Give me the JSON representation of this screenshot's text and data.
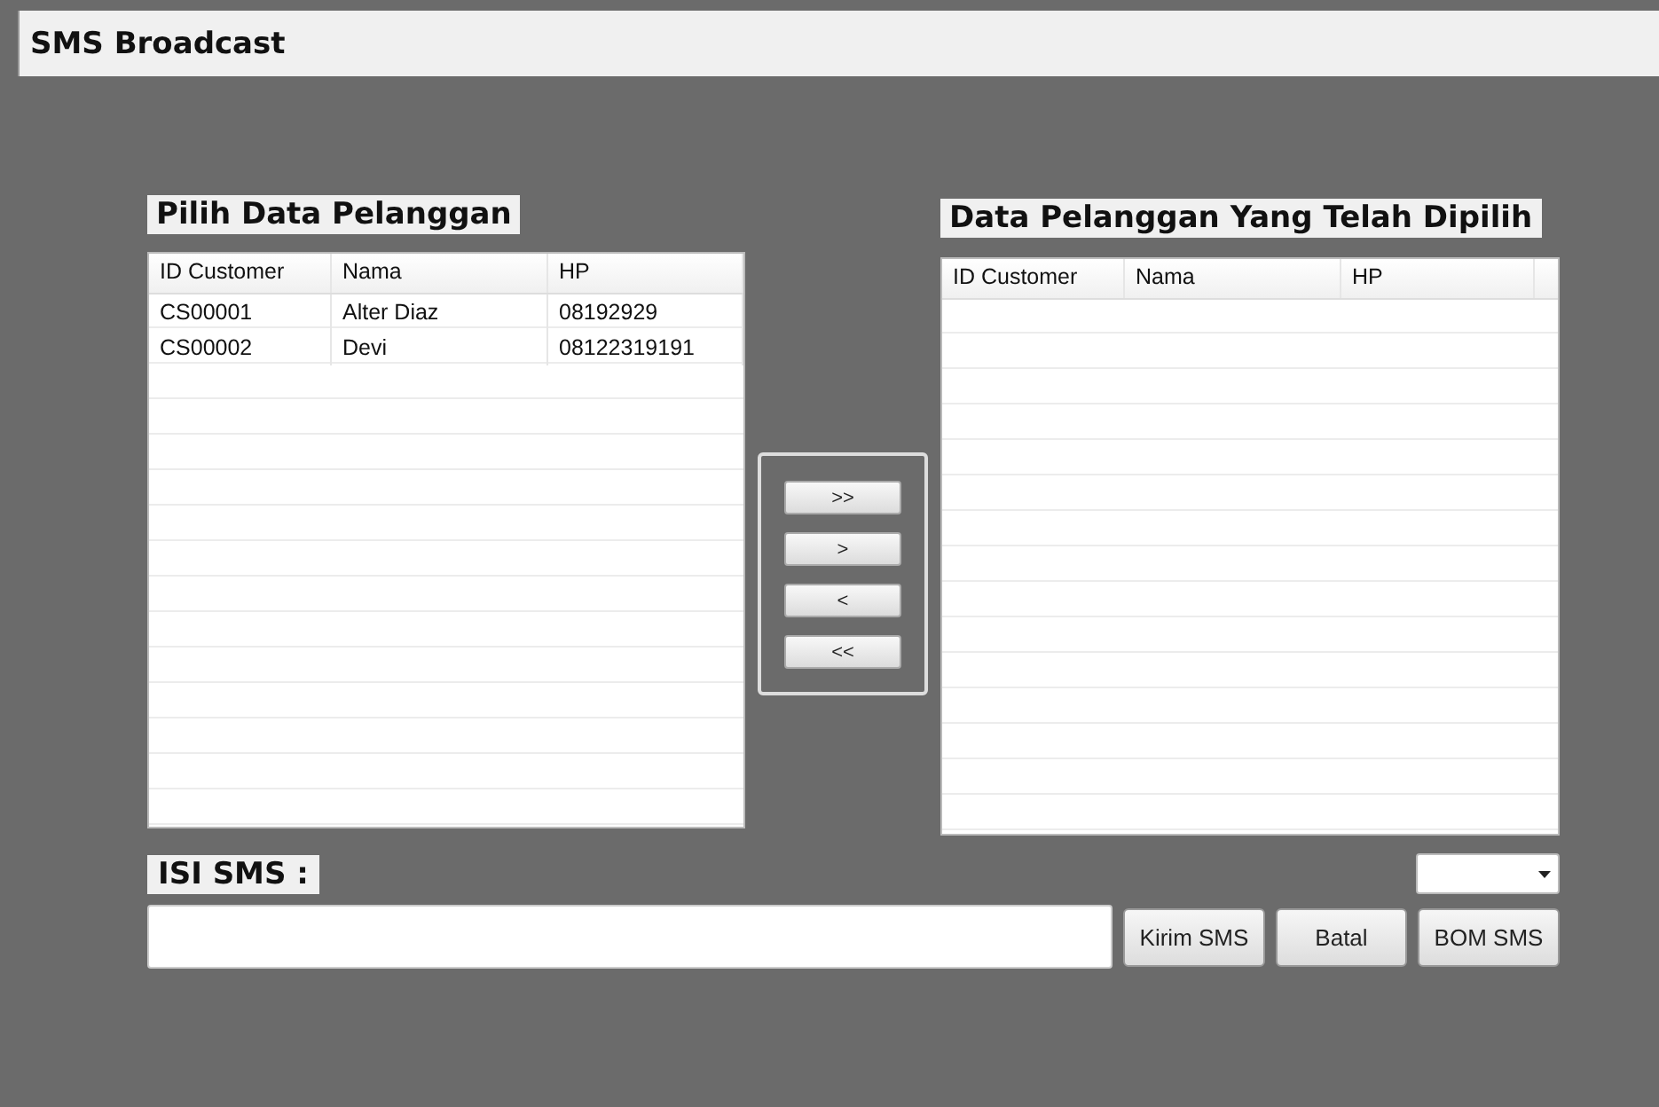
{
  "window": {
    "title": "SMS Broadcast"
  },
  "source_panel": {
    "heading": "Pilih Data Pelanggan",
    "columns": [
      "ID Customer",
      "Nama",
      "HP"
    ],
    "rows": [
      [
        "CS00001",
        "Alter Diaz",
        "08192929"
      ],
      [
        "CS00002",
        "Devi",
        "08122319191"
      ]
    ]
  },
  "transfer_buttons": [
    ">>",
    ">",
    "<",
    "<<"
  ],
  "selected_panel": {
    "heading": "Data Pelanggan Yang Telah Dipilih",
    "columns": [
      "ID Customer",
      "Nama",
      "HP"
    ]
  },
  "sms": {
    "label": "ISI SMS :"
  },
  "actions": [
    "Kirim SMS",
    "Batal",
    "BOM SMS"
  ]
}
